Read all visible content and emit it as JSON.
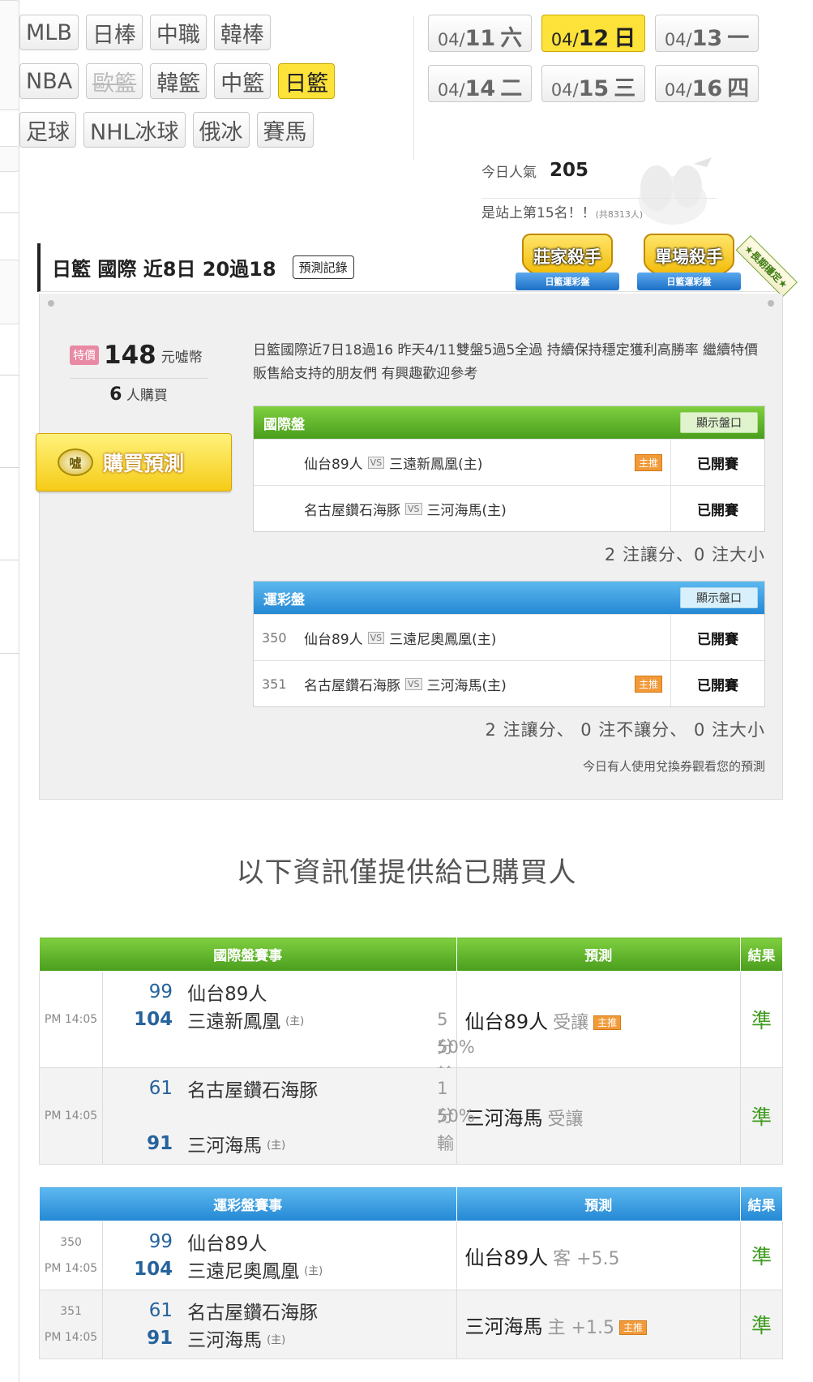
{
  "sports": [
    [
      {
        "label": "MLB"
      },
      {
        "label": "日棒"
      },
      {
        "label": "中職"
      },
      {
        "label": "韓棒"
      }
    ],
    [
      {
        "label": "NBA"
      },
      {
        "label": "歐籃",
        "disabled": true
      },
      {
        "label": "韓籃"
      },
      {
        "label": "中籃"
      },
      {
        "label": "日籃",
        "active": true
      }
    ],
    [
      {
        "label": "足球"
      },
      {
        "label": "NHL冰球"
      },
      {
        "label": "俄冰"
      },
      {
        "label": "賽馬"
      }
    ]
  ],
  "dates": [
    {
      "mo": "04/",
      "dd": "11",
      "wd": "六"
    },
    {
      "mo": "04/",
      "dd": "12",
      "wd": "日",
      "active": true
    },
    {
      "mo": "04/",
      "dd": "13",
      "wd": "一"
    },
    {
      "mo": "04/",
      "dd": "14",
      "wd": "二"
    },
    {
      "mo": "04/",
      "dd": "15",
      "wd": "三"
    },
    {
      "mo": "04/",
      "dd": "16",
      "wd": "四"
    }
  ],
  "popularity": {
    "label": "今日人氣",
    "value": "205",
    "rank_text": "是站上第15名！！",
    "total_text": "(共8313人)"
  },
  "predictor": {
    "title": "日籃 國際 近8日 20過18",
    "record_button": "預測記錄",
    "badges": [
      {
        "title": "莊家殺手",
        "ribbon": "日籃運彩盤"
      },
      {
        "title": "單場殺手",
        "ribbon": "日籃運彩盤"
      }
    ],
    "corner_ribbon": "★長期穩定★",
    "price_tag": "特價",
    "price": "148",
    "price_unit": "元噓幣",
    "buyers_count": "6",
    "buyers_label": "人購買",
    "buy_button": "購買預測",
    "buy_coin": "噓",
    "description": "日籃國際近7日18過16 昨天4/11雙盤5過5全過 持續保持穩定獲利高勝率 繼續特價販售給支持的朋友們 有興趣歡迎參考",
    "coupon_note": "今日有人使用兌換券觀看您的預測"
  },
  "intl_table": {
    "title": "國際盤",
    "show_button": "顯示盤口",
    "rows": [
      {
        "num": "",
        "away": "仙台89人",
        "home": "三遠新鳳凰(主)",
        "tag": "主推",
        "status": "已開賽"
      },
      {
        "num": "",
        "away": "名古屋鑽石海豚",
        "home": "三河海馬(主)",
        "tag": "",
        "status": "已開賽"
      }
    ],
    "summary": "2 注讓分、0 注大小"
  },
  "lottery_table": {
    "title": "運彩盤",
    "show_button": "顯示盤口",
    "rows": [
      {
        "num": "350",
        "away": "仙台89人",
        "home": "三遠尼奧鳳凰(主)",
        "tag": "",
        "status": "已開賽"
      },
      {
        "num": "351",
        "away": "名古屋鑽石海豚",
        "home": "三河海馬(主)",
        "tag": "主推",
        "status": "已開賽"
      }
    ],
    "summary": "2 注讓分、 0 注不讓分、 0 注大小"
  },
  "vs_label": "VS",
  "buyer_only_text": "以下資訊僅提供給已購買人",
  "intl_results": {
    "headers": [
      "國際盤賽事",
      "預測",
      "結果"
    ],
    "rows": [
      {
        "time": "PM 14:05",
        "away_score": "99",
        "away": "仙台89人",
        "home_score": "104",
        "home": "三遠新鳳凰",
        "home_mark": "(主)",
        "loss": "5分輸",
        "pct": "50%",
        "pred_team": "仙台89人",
        "pred_extra": "受讓",
        "pred_tag": "主推",
        "result": "準"
      },
      {
        "time": "PM 14:05",
        "away_score": "61",
        "away": "名古屋鑽石海豚",
        "home_score": "91",
        "home": "三河海馬",
        "home_mark": "(主)",
        "loss": "1分輸",
        "pct": "50%",
        "pred_team": "三河海馬",
        "pred_extra": "受讓",
        "pred_tag": "",
        "result": "準"
      }
    ]
  },
  "lottery_results": {
    "headers": [
      "運彩盤賽事",
      "預測",
      "結果"
    ],
    "rows": [
      {
        "num": "350",
        "time": "PM 14:05",
        "away_score": "99",
        "away": "仙台89人",
        "home_score": "104",
        "home": "三遠尼奧鳳凰",
        "home_mark": "(主)",
        "pred_team": "仙台89人",
        "pred_extra": "客 +5.5",
        "pred_tag": "",
        "result": "準"
      },
      {
        "num": "351",
        "time": "PM 14:05",
        "away_score": "61",
        "away": "名古屋鑽石海豚",
        "home_score": "91",
        "home": "三河海馬",
        "home_mark": "(主)",
        "pred_team": "三河海馬",
        "pred_extra": "主 +1.5",
        "pred_tag": "主推",
        "result": "準"
      }
    ]
  },
  "colors": {
    "accent_yellow": "#fde23a",
    "green_header": "#5fb22b",
    "blue_header": "#3a9ae0",
    "result_green": "#3d9b1d",
    "score_blue": "#26639c"
  }
}
